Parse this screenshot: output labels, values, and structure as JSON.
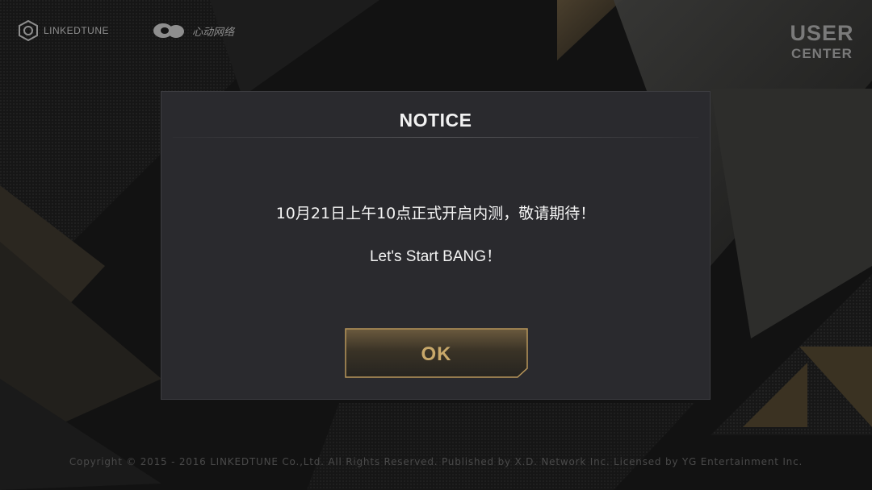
{
  "brand": {
    "linkedtune_logo_text": "LINKEDTUNE",
    "xd_logo_text": "心动网络"
  },
  "header": {
    "user_center_line1": "USER",
    "user_center_line2": "CENTER"
  },
  "dialog": {
    "title": "NOTICE",
    "message_line1": "10月21日上午10点正式开启内测，敬请期待！",
    "message_line2": "Let's Start BANG！",
    "ok_label": "OK"
  },
  "footer": {
    "copyright": "Copyright © 2015 - 2016 LINKEDTUNE Co.,Ltd. All Rights Reserved. Published by X.D. Network Inc. Licensed by YG Entertainment Inc."
  },
  "colors": {
    "background": "#141414",
    "dialog_bg": "#2a2a2e",
    "accent_gold": "#c8a86a",
    "text_primary": "#f4f4f4",
    "muted_logo": "#8e8e8e"
  },
  "icons": {
    "linkedtune": "linkedtune-logo-icon",
    "xd": "xd-network-logo-icon"
  }
}
